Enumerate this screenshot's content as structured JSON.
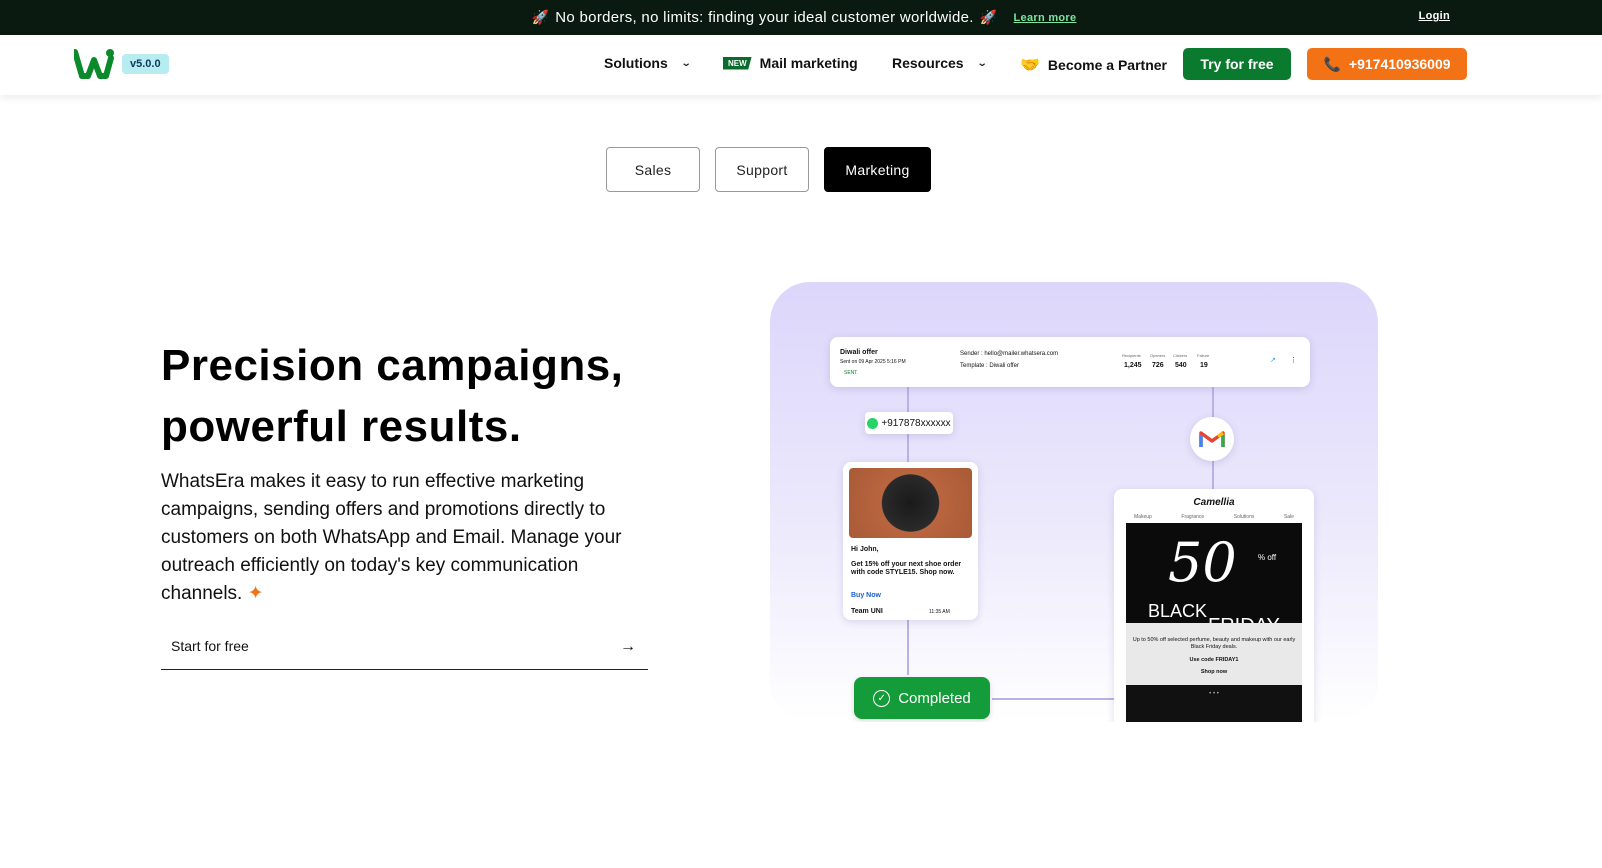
{
  "announcement": {
    "text": "No borders, no limits: finding your ideal customer worldwide.",
    "learn_more": "Learn more",
    "login": "Login"
  },
  "nav": {
    "version": "v5.0.0",
    "solutions": "Solutions",
    "new_badge": "NEW",
    "mail_marketing": "Mail marketing",
    "resources": "Resources",
    "partner": "Become a Partner",
    "try_free": "Try for free",
    "phone": "+917410936009"
  },
  "tabs": [
    "Sales",
    "Support",
    "Marketing"
  ],
  "hero": {
    "title_line1": "Precision campaigns,",
    "title_line2": "powerful results.",
    "description": "WhatsEra makes it easy to run effective marketing campaigns, sending offers and promotions directly to customers on both WhatsApp and Email. Manage your outreach efficiently on today's key communication channels.",
    "cta": "Start for free"
  },
  "illustration": {
    "campaign": {
      "name": "Diwali offer",
      "sent_on": "Sent on 09 Apr 2025 5:16 PM",
      "status": "SENT",
      "sender": "Sender : hello@mailer.whatsera.com",
      "template": "Template : Diwali offer",
      "stats_labels": [
        "Recipients",
        "Openers",
        "Clickers",
        "Failure"
      ],
      "stats_values": [
        "1,245",
        "726",
        "540",
        "19"
      ]
    },
    "phone_chip": "+917878xxxxxx",
    "wa_message": {
      "greeting": "Hi John,",
      "body": "Get 15% off your next shoe order with code STYLE15. Shop now.",
      "link": "Buy Now",
      "signature": "Team UNI",
      "time": "11:35 AM"
    },
    "mail": {
      "brand": "Camellia",
      "menu": [
        "Makeup",
        "Fragrance",
        "Solutions",
        "Sale"
      ],
      "number": "50",
      "pct": "% off",
      "word1": "BLACK",
      "word2": "FRIDAY",
      "body": "Up to 50% off selected perfume, beauty and makeup with our early Black Friday deals.",
      "code": "Use code FRIDAY1",
      "shop": "Shop now"
    },
    "completed": "Completed"
  }
}
